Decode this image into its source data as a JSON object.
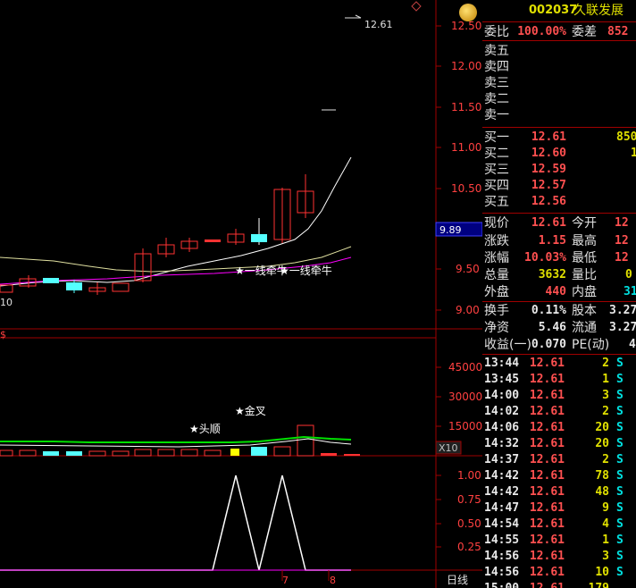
{
  "header": {
    "code": "002037",
    "name": "久联发展",
    "settings_icon": "diamond-icon"
  },
  "colors": {
    "up": "#ff3232",
    "down": "#54ffff",
    "ma_white": "#ffffff",
    "ma_yellow": "#e0e000",
    "ma_magenta": "#ff00ff",
    "vol_green": "#00e000",
    "border": "#a00000",
    "axis_text": "#ff4040"
  },
  "main_chart": {
    "price_axis": [
      "12.50",
      "12.00",
      "11.50",
      "11.00",
      "10.50",
      "10.00",
      "9.50",
      "9.00"
    ],
    "max_label": "12.61",
    "min_label": "10",
    "current_price_tag": "9.89",
    "annotation_1": "★一线牵牛",
    "annotation_2": "★一线牵牛",
    "corner_mark": "$"
  },
  "volume_chart": {
    "axis": [
      "45000",
      "30000",
      "15000"
    ],
    "unit": "X10",
    "annotation_1": "★头顺",
    "annotation_2": "★金叉"
  },
  "indicator_chart": {
    "axis": [
      "1.00",
      "0.75",
      "0.50",
      "0.25"
    ],
    "period_label": "日线",
    "x_marks": [
      "7",
      "8"
    ]
  },
  "order_book": {
    "ratio_label": "委比",
    "ratio_value": "100.00%",
    "diff_label": "委差",
    "diff_value": "852",
    "sells": [
      {
        "label": "卖五",
        "price": "",
        "vol": ""
      },
      {
        "label": "卖四",
        "price": "",
        "vol": ""
      },
      {
        "label": "卖三",
        "price": "",
        "vol": ""
      },
      {
        "label": "卖二",
        "price": "",
        "vol": ""
      },
      {
        "label": "卖一",
        "price": "",
        "vol": ""
      }
    ],
    "buys": [
      {
        "label": "买一",
        "price": "12.61",
        "vol": "850"
      },
      {
        "label": "买二",
        "price": "12.60",
        "vol": "1"
      },
      {
        "label": "买三",
        "price": "12.59",
        "vol": ""
      },
      {
        "label": "买四",
        "price": "12.57",
        "vol": ""
      },
      {
        "label": "买五",
        "price": "12.56",
        "vol": ""
      }
    ]
  },
  "quote": {
    "rows": [
      {
        "l1": "现价",
        "v1": "12.61",
        "c1": "red",
        "l2": "今开",
        "v2": "12"
      },
      {
        "l1": "涨跌",
        "v1": "1.15",
        "c1": "red",
        "l2": "最高",
        "v2": "12"
      },
      {
        "l1": "涨幅",
        "v1": "10.03%",
        "c1": "red",
        "l2": "最低",
        "v2": "12"
      },
      {
        "l1": "总量",
        "v1": "3632",
        "c1": "yel",
        "l2": "量比",
        "v2": "0"
      },
      {
        "l1": "外盘",
        "v1": "440",
        "c1": "red",
        "l2": "内盘",
        "v2": "31"
      }
    ],
    "rows2": [
      {
        "l1": "换手",
        "v1": "0.11%",
        "c1": "white",
        "l2": "股本",
        "v2": "3.27"
      },
      {
        "l1": "净资",
        "v1": "5.46",
        "c1": "white",
        "l2": "流通",
        "v2": "3.27"
      },
      {
        "l1": "收益(一)",
        "v1": "0.070",
        "c1": "white",
        "l2": "PE(动)",
        "v2": "4"
      }
    ]
  },
  "ticks": [
    {
      "time": "13:44",
      "price": "12.61",
      "vol": "2",
      "side": "S"
    },
    {
      "time": "13:45",
      "price": "12.61",
      "vol": "1",
      "side": "S"
    },
    {
      "time": "14:00",
      "price": "12.61",
      "vol": "3",
      "side": "S"
    },
    {
      "time": "14:02",
      "price": "12.61",
      "vol": "2",
      "side": "S"
    },
    {
      "time": "14:06",
      "price": "12.61",
      "vol": "20",
      "side": "S"
    },
    {
      "time": "14:32",
      "price": "12.61",
      "vol": "20",
      "side": "S"
    },
    {
      "time": "14:37",
      "price": "12.61",
      "vol": "2",
      "side": "S"
    },
    {
      "time": "14:42",
      "price": "12.61",
      "vol": "78",
      "side": "S"
    },
    {
      "time": "14:42",
      "price": "12.61",
      "vol": "48",
      "side": "S"
    },
    {
      "time": "14:47",
      "price": "12.61",
      "vol": "9",
      "side": "S"
    },
    {
      "time": "14:54",
      "price": "12.61",
      "vol": "4",
      "side": "S"
    },
    {
      "time": "14:55",
      "price": "12.61",
      "vol": "1",
      "side": "S"
    },
    {
      "time": "14:56",
      "price": "12.61",
      "vol": "3",
      "side": "S"
    },
    {
      "time": "14:56",
      "price": "12.61",
      "vol": "10",
      "side": "S"
    },
    {
      "time": "15:00",
      "price": "12.61",
      "vol": "179",
      "side": ""
    }
  ]
}
